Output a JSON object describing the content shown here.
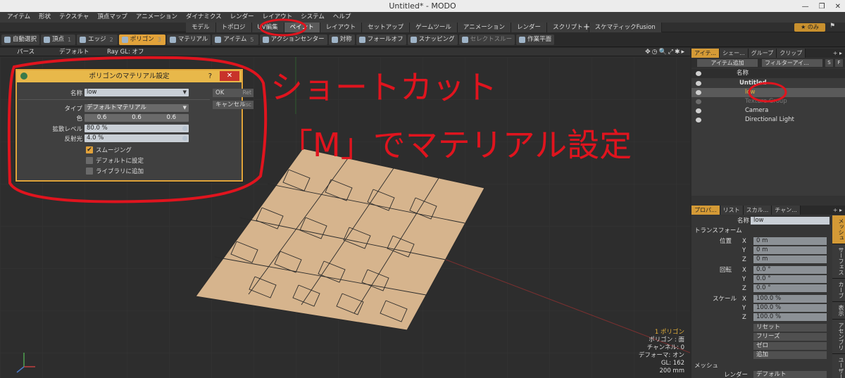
{
  "window": {
    "title": "Untitled* - MODO",
    "controls": [
      "—",
      "❐",
      "✕"
    ]
  },
  "menu": [
    "アイテム",
    "形状",
    "テクスチャ",
    "頂点マップ",
    "アニメーション",
    "ダイナミクス",
    "レンダー",
    "レイアウト",
    "システム",
    "ヘルプ"
  ],
  "layout_tabs": [
    {
      "label": "モデル",
      "active": false
    },
    {
      "label": "トポロジ",
      "active": false
    },
    {
      "label": "UV編集",
      "active": false
    },
    {
      "label": "ペイント",
      "active": true
    },
    {
      "label": "レイアウト",
      "active": false
    },
    {
      "label": "セットアップ",
      "active": false
    },
    {
      "label": "ゲームツール",
      "active": false
    },
    {
      "label": "アニメーション",
      "active": false
    },
    {
      "label": "レンダー",
      "active": false
    },
    {
      "label": "スクリプト",
      "active": false
    },
    {
      "label": "スケマティックFusion",
      "active": false
    }
  ],
  "only_button": "★ のみ",
  "toolbar": {
    "auto_select": "自動選択",
    "vertex": "頂点",
    "vertex_num": "1",
    "edge": "エッジ",
    "edge_num": "2",
    "polygon": "ポリゴン",
    "polygon_num": "3",
    "material": "マテリアル",
    "item": "アイテム",
    "item_num": "5",
    "action_center": "アクションセンター",
    "symmetry": "対称",
    "falloff": "フォールオフ",
    "snapping": "スナッピング",
    "select_through": "セレクトスルー",
    "work_plane": "作業平面"
  },
  "viewport_bar": {
    "persp": "パース",
    "default": "デフォルト",
    "ray": "Ray GL: オフ"
  },
  "dialog": {
    "title": "ポリゴンのマテリアル設定",
    "help": "?",
    "close": "✕",
    "name_label": "名称",
    "name_value": "low",
    "type_label": "タイプ",
    "type_value": "デフォルトマテリアル",
    "color_label": "色",
    "color_values": [
      "0.6",
      "0.6",
      "0.6"
    ],
    "diffuse_label": "拡散レベル",
    "diffuse_value": "80.0 %",
    "reflect_label": "反射光",
    "reflect_value": "4.0 %",
    "smoothing": "スムージング",
    "set_default": "デフォルトに設定",
    "add_library": "ライブラリに追加",
    "ok": "OK",
    "ok_key": "Ret",
    "cancel": "キャンセル",
    "cancel_key": "Esc"
  },
  "viewport_info": {
    "line1": "1 ポリゴン",
    "line2": "ポリゴン : 面",
    "line3": "チャンネル: 0",
    "line4": "デフォーマ: オン",
    "line5": "GL: 162",
    "line6": "200 mm"
  },
  "items_panel": {
    "tabs": [
      "アイテ...",
      "シェー...",
      "グループ",
      "クリップ"
    ],
    "add_item": "アイテム追加",
    "filter": "フィルターアイ...",
    "col_name": "名称",
    "rows": [
      {
        "name": "Untitled",
        "selected": false
      },
      {
        "name": "low",
        "selected": true
      },
      {
        "name": "Texture Group",
        "selected": false
      },
      {
        "name": "Camera",
        "selected": false
      },
      {
        "name": "Directional Light",
        "selected": false
      }
    ]
  },
  "props_panel": {
    "tabs": [
      "プロパ...",
      "リスト",
      "スカル...",
      "チャン..."
    ],
    "name_label": "名称",
    "name_value": "low",
    "transform": "トランスフォーム",
    "position_label": "位置",
    "rotation_label": "回転",
    "scale_label": "スケール",
    "axes": [
      "X",
      "Y",
      "Z"
    ],
    "position": [
      "0 m",
      "0 m",
      "0 m"
    ],
    "rotation": [
      "0.0 °",
      "0.0 °",
      "0.0 °"
    ],
    "scale": [
      "100.0 %",
      "100.0 %",
      "100.0 %"
    ],
    "reset": "リセット",
    "freeze": "フリーズ",
    "zero": "ゼロ",
    "add": "追加",
    "mesh": "メッシュ",
    "render_label": "レンダー",
    "render_value": "デフォルト",
    "side_tabs": [
      "メッシュ",
      "サーフェス",
      "カーブ",
      "表示",
      "アセンブリ",
      "ユーザーチャ"
    ]
  },
  "annotation": {
    "line1": "ショートカット",
    "line2": "「M」でマテリアル設定",
    "color": "#e0141e"
  },
  "colors": {
    "accent": "#e2a23a",
    "panel": "#333333",
    "mesh": "#d6b48d"
  }
}
